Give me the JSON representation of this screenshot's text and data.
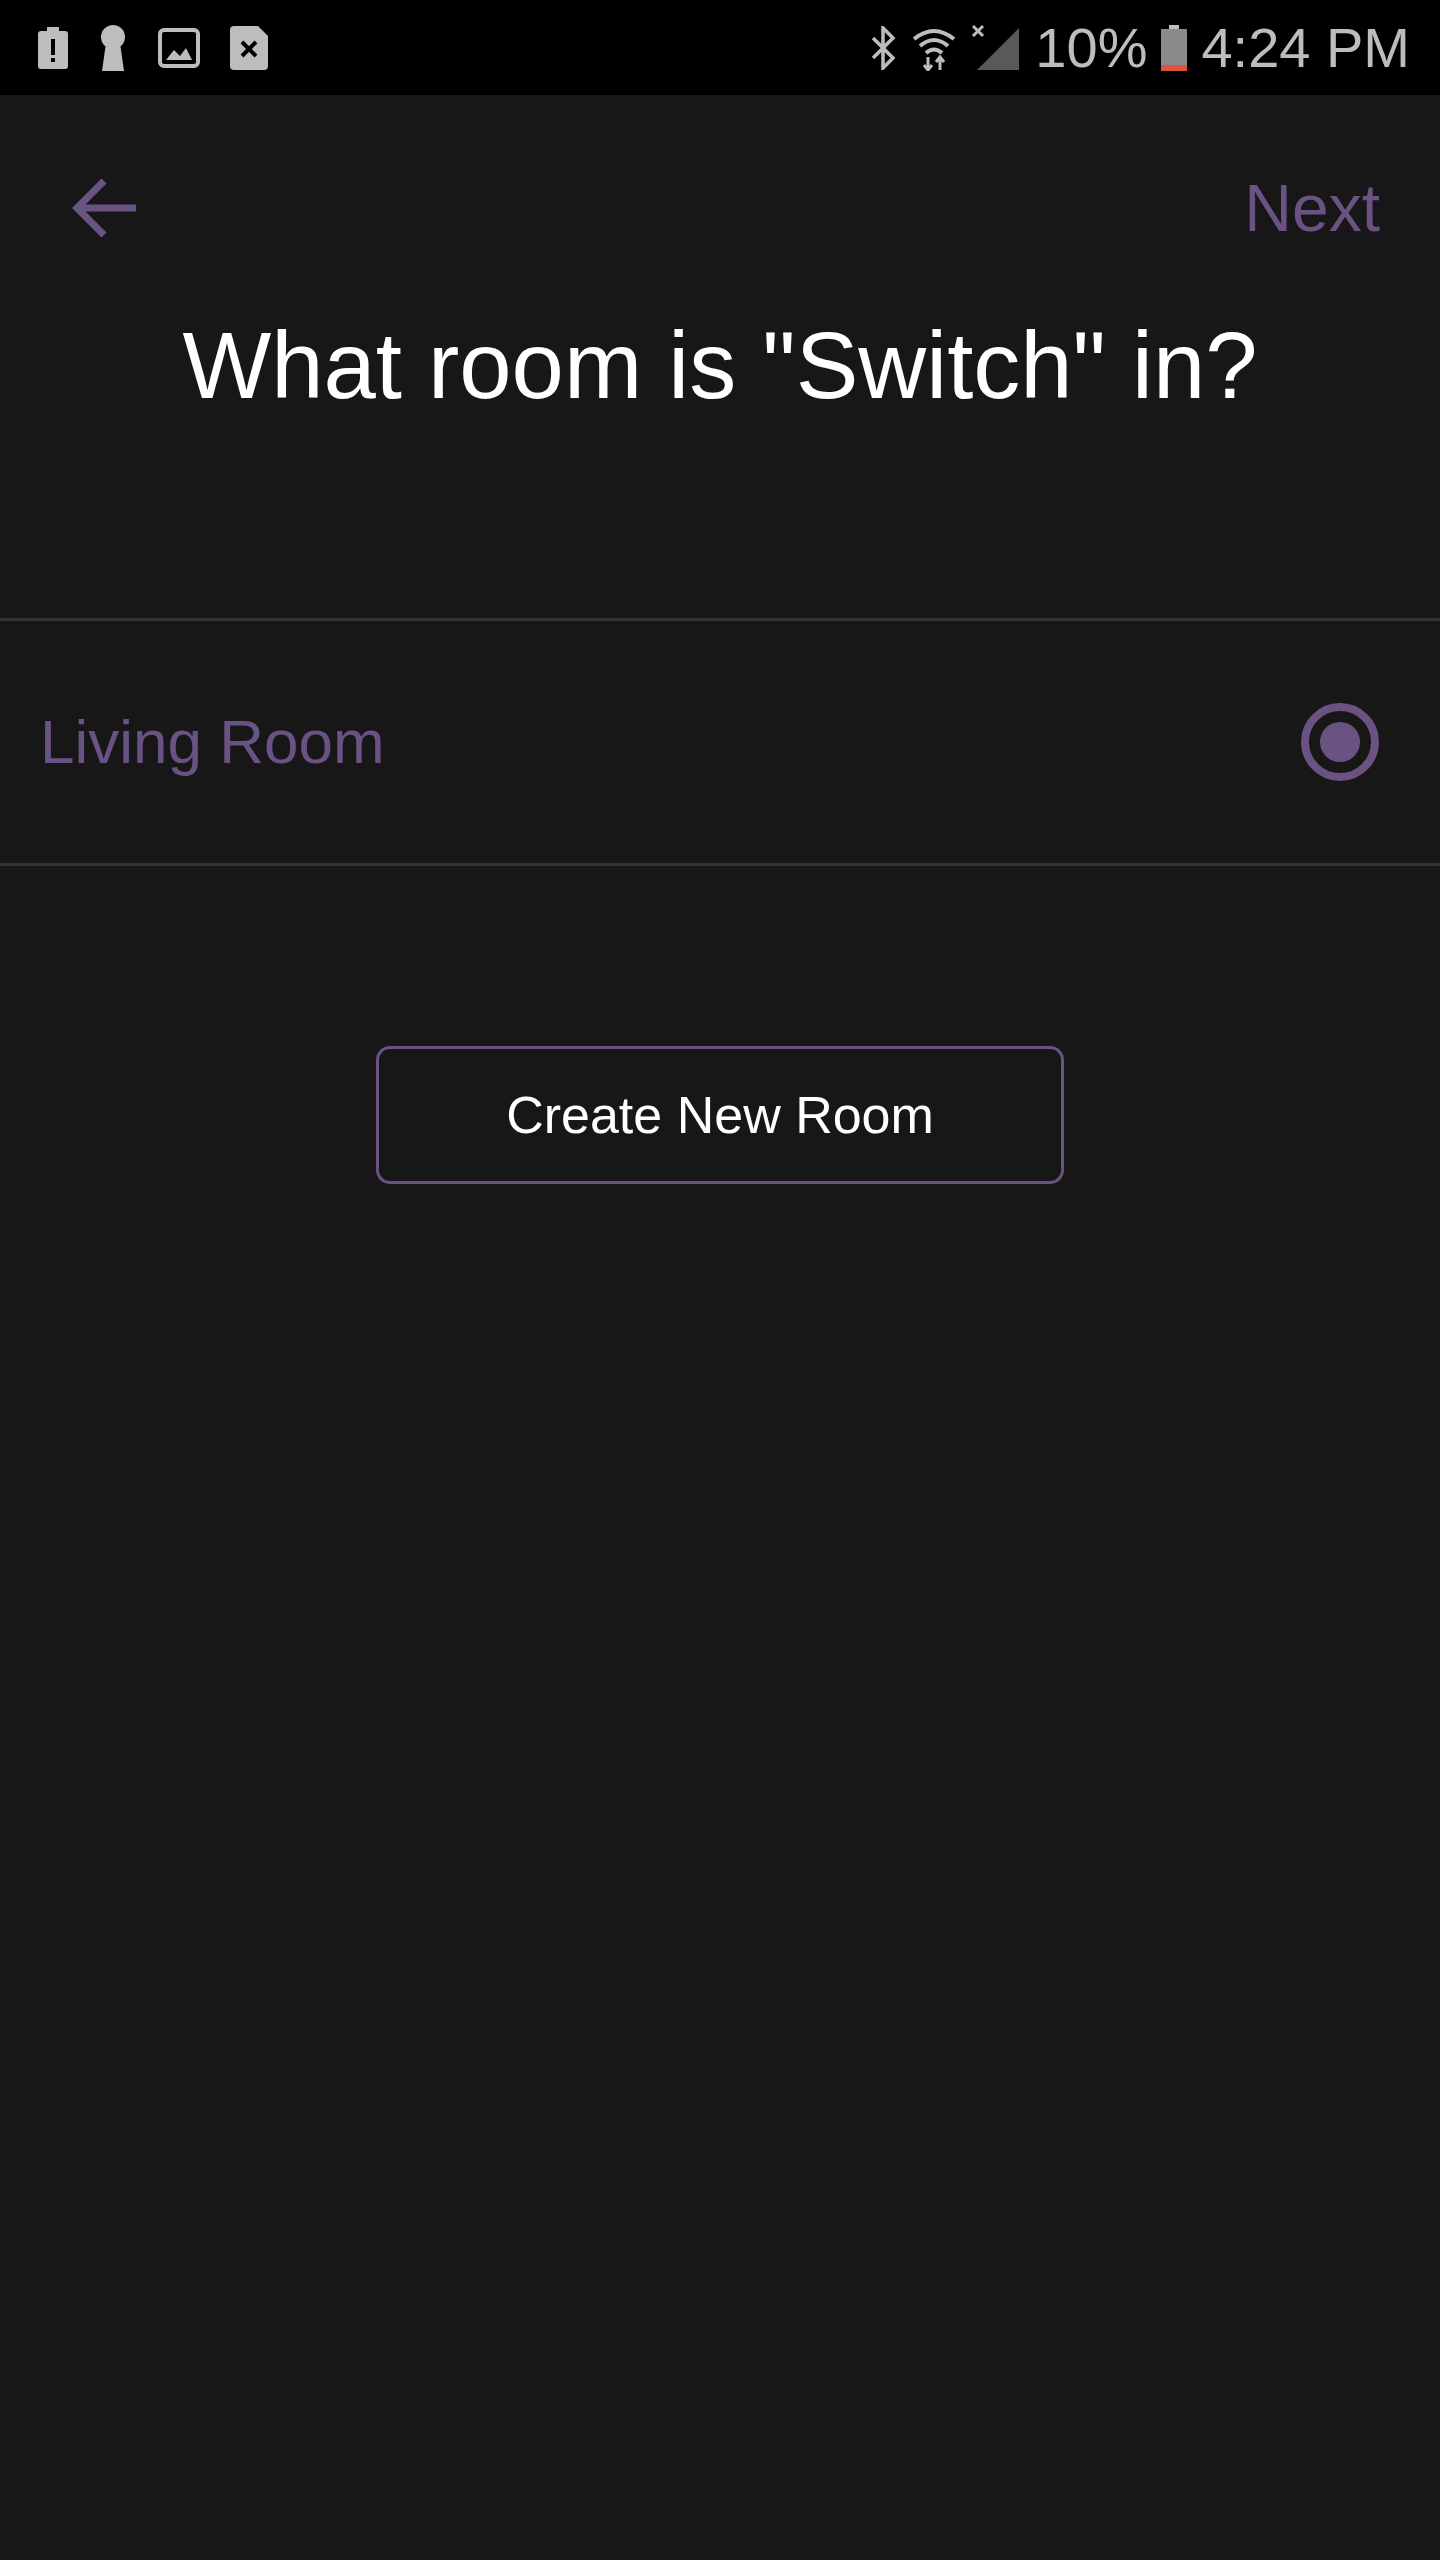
{
  "status_bar": {
    "battery": "10%",
    "time": "4:24 PM"
  },
  "nav": {
    "next": "Next"
  },
  "title": "What room is \"Switch\" in?",
  "rooms": [
    {
      "name": "Living Room",
      "selected": true
    }
  ],
  "create_button": "Create New Room"
}
